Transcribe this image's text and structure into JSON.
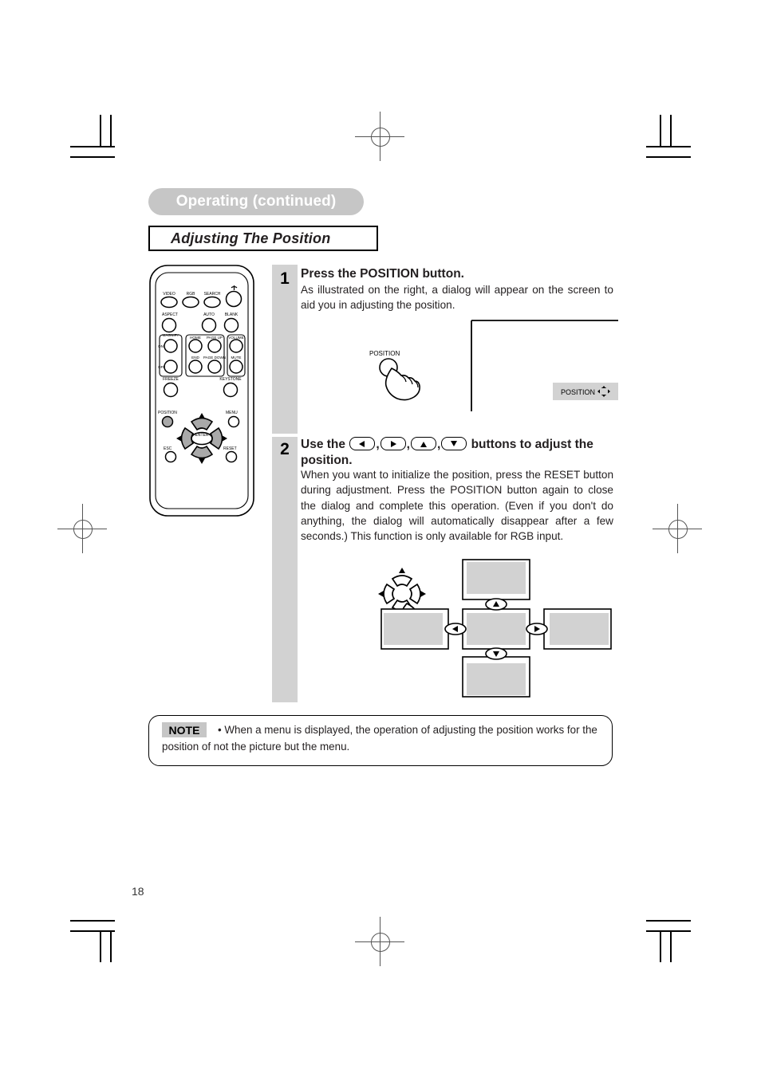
{
  "header": {
    "title": "Operating (continued)",
    "section_title": "Adjusting The Position",
    "title_bg": "#c6c6c6",
    "title_color": "#ffffff"
  },
  "steps": [
    {
      "number": "1",
      "heading": "Press the POSITION button.",
      "body": "As illustrated on the right, a dialog will appear on the screen to aid you in adjusting the position."
    },
    {
      "number": "2",
      "heading_prefix": "Use the",
      "heading_suffix": "buttons to adjust the position.",
      "heading_buttons": [
        "left-arrow",
        "right-arrow",
        "up-arrow",
        "down-arrow"
      ],
      "body": "When you want to initialize the position, press the RESET button during adjustment. Press the POSITION button again to close the dialog and complete this operation.  (Even if you don't do anything, the dialog will automatically disappear after a few seconds.) This function is only available for RGB input."
    }
  ],
  "remote": {
    "buttons": [
      {
        "label": "VIDEO"
      },
      {
        "label": "RGB"
      },
      {
        "label": "SEARCH"
      },
      {
        "label": "STANDBY/ON"
      },
      {
        "label": "ASPECT"
      },
      {
        "label": "AUTO"
      },
      {
        "label": "BLANK"
      },
      {
        "label": "MAGNIFY"
      },
      {
        "label": "ON"
      },
      {
        "label": "OFF"
      },
      {
        "label": "HOME"
      },
      {
        "label": "PAGE UP"
      },
      {
        "label": "END"
      },
      {
        "label": "PAGE DOWN"
      },
      {
        "label": "VOLUME"
      },
      {
        "label": "MUTE"
      },
      {
        "label": "FREEZE"
      },
      {
        "label": "KEYSTONE"
      },
      {
        "label": "POSITION"
      },
      {
        "label": "MENU"
      },
      {
        "label": "ENTER"
      },
      {
        "label": "ESC"
      },
      {
        "label": "RESET"
      }
    ],
    "labels": {
      "video": "VIDEO",
      "rgb": "RGB",
      "search": "SEARCH",
      "aspect": "ASPECT",
      "auto": "AUTO",
      "blank": "BLANK",
      "magnify": "MAGNIFY",
      "on": "ON",
      "off": "OFF",
      "home": "HOME",
      "page_up": "PAGE UP",
      "end": "END",
      "page_down": "PAGE DOWN",
      "volume": "VOLUME",
      "mute": "MUTE",
      "freeze": "FREEZE",
      "keystone": "KEYSTONE",
      "position": "POSITION",
      "menu": "MENU",
      "enter": "ENTER",
      "esc": "ESC",
      "reset": "RESET"
    }
  },
  "dialog_illustration": {
    "button_label": "POSITION",
    "osd_label": "POSITION",
    "osd_bg": "#d2d2d2"
  },
  "note": {
    "badge": "NOTE",
    "text": "• When a menu is displayed, the operation of adjusting the position works for the position of not the picture but the menu.",
    "badge_bg": "#c6c6c6"
  },
  "footer": {
    "page_number": "18"
  }
}
